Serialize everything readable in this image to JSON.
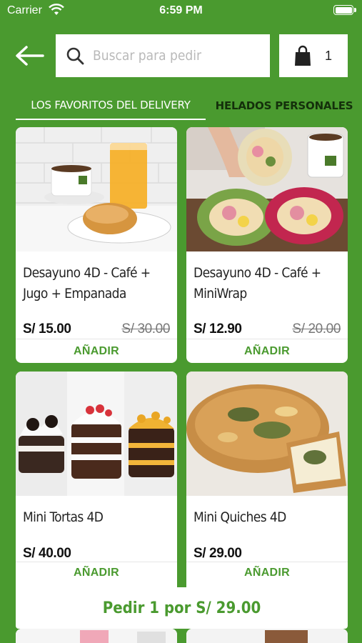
{
  "status_bar": {
    "carrier": "Carrier",
    "time": "6:59 PM"
  },
  "header": {
    "back_icon": "arrow-left-icon",
    "search_placeholder": "Buscar para pedir",
    "cart_count": "1",
    "cart_icon": "shopping-bag-icon"
  },
  "tabs": [
    {
      "label": "LOS FAVORITOS DEL DELIVERY",
      "active": true
    },
    {
      "label": "HELADOS PERSONALES",
      "active": false
    }
  ],
  "products": [
    {
      "name": "Desayuno 4D - Café + Jugo + Empanada",
      "price": "S/ 15.00",
      "old_price": "S/ 30.00",
      "button": "AÑADIR"
    },
    {
      "name": "Desayuno 4D - Café + MiniWrap",
      "price": "S/ 12.90",
      "old_price": "S/ 20.00",
      "button": "AÑADIR"
    },
    {
      "name": "Mini Tortas 4D",
      "price": "S/ 40.00",
      "old_price": "",
      "button": "AÑADIR"
    },
    {
      "name": "Mini Quiches 4D",
      "price": "S/ 29.00",
      "old_price": "",
      "button": "AÑADIR"
    }
  ],
  "order_bar": {
    "label": "Pedir 1 por S/ 29.00"
  },
  "colors": {
    "brand_green": "#4a9a2f",
    "dark_tab": "#14300b",
    "white": "#ffffff"
  }
}
